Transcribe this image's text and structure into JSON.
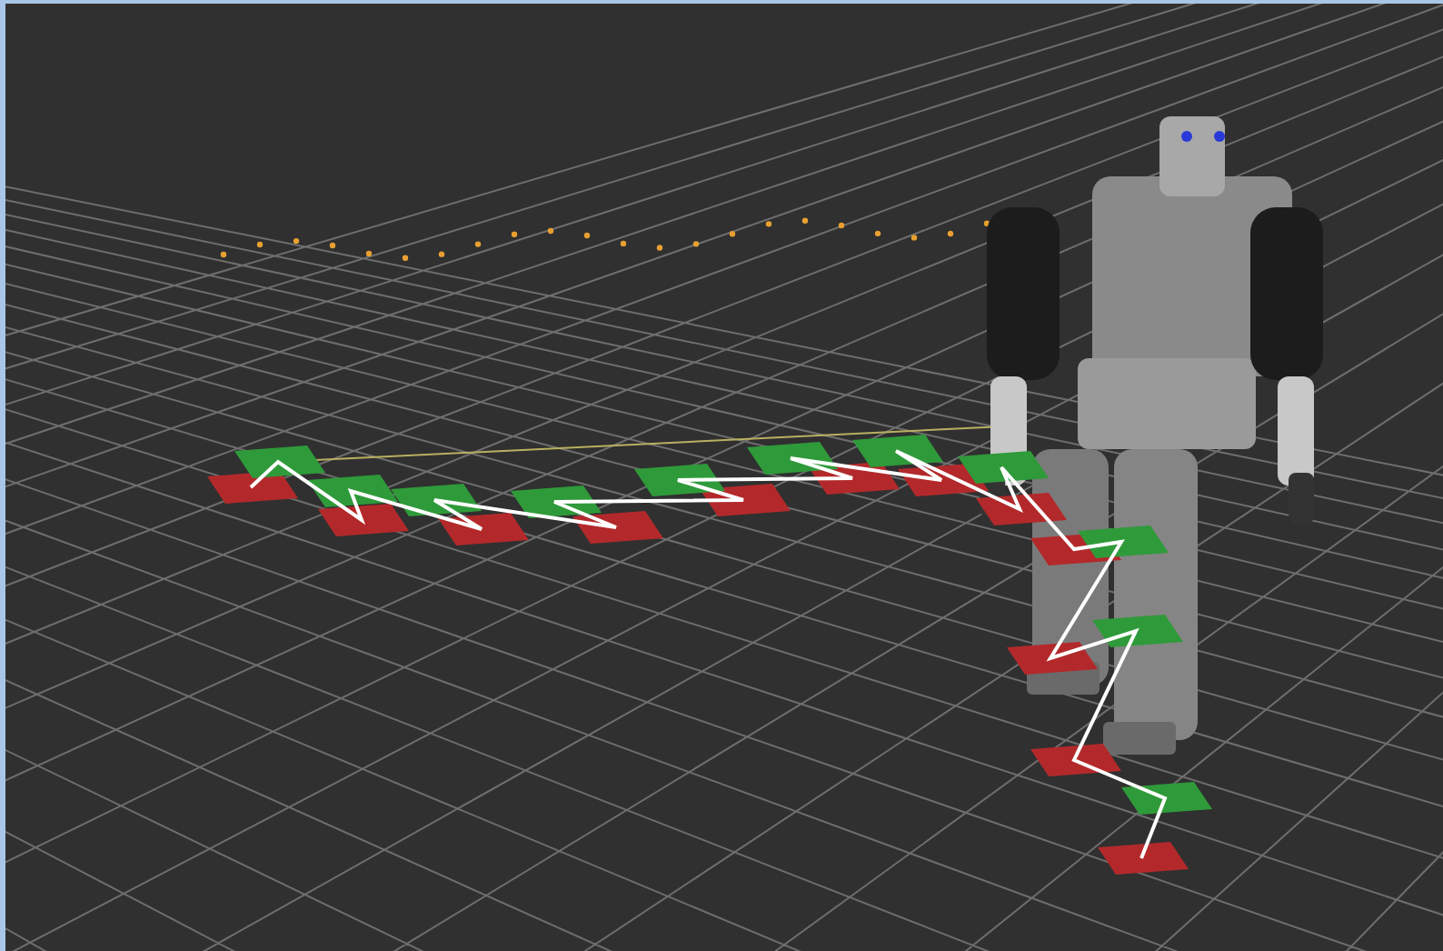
{
  "scene": {
    "footsteps": [
      {
        "color": "#b3292b"
      },
      {
        "color": "#2f9a3a"
      },
      {
        "color": "#b3292b"
      },
      {
        "color": "#2f9a3a"
      },
      {
        "color": "#b3292b"
      },
      {
        "color": "#2f9a3a"
      },
      {
        "color": "#b3292b"
      },
      {
        "color": "#2f9a3a"
      },
      {
        "color": "#b3292b"
      },
      {
        "color": "#2f9a3a"
      },
      {
        "color": "#b3292b"
      },
      {
        "color": "#2f9a3a"
      },
      {
        "color": "#b3292b"
      },
      {
        "color": "#2f9a3a"
      },
      {
        "color": "#b3292b"
      },
      {
        "color": "#2f9a3a"
      },
      {
        "color": "#b3292b"
      },
      {
        "color": "#2f9a3a"
      },
      {
        "color": "#b3292b"
      },
      {
        "color": "#2f9a3a"
      },
      {
        "color": "#b3292b"
      },
      {
        "color": "#2f9a3a"
      },
      {
        "color": "#b3292b"
      }
    ]
  }
}
